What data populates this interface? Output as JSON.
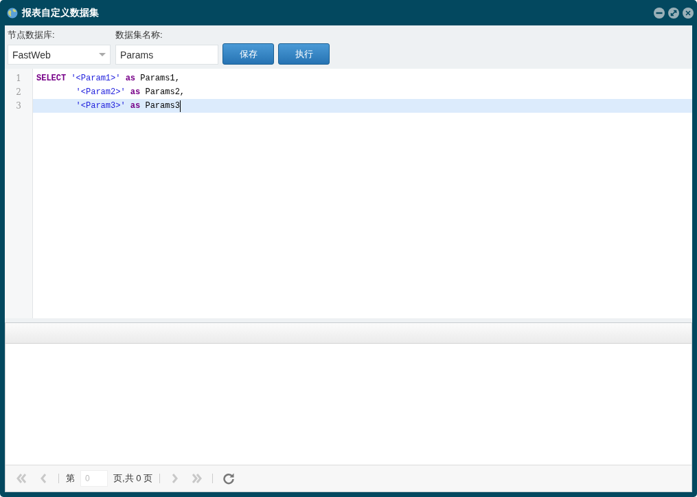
{
  "window": {
    "title": "报表自定义数据集"
  },
  "form": {
    "database": {
      "label": "节点数据库:",
      "value": "FastWeb"
    },
    "name": {
      "label": "数据集名称:",
      "value": "Params"
    },
    "buttons": [
      "保存",
      "执行"
    ]
  },
  "editor": {
    "lines": [
      {
        "number": "1",
        "selected": false,
        "indented": false,
        "tokens": [
          {
            "kind": "keyword",
            "text": "SELECT"
          },
          {
            "kind": "string",
            "text": "'<Param1>'"
          },
          {
            "kind": "keyword",
            "text": "as"
          },
          {
            "kind": "plain",
            "text": "Params1,"
          }
        ]
      },
      {
        "number": "2",
        "selected": false,
        "indented": true,
        "tokens": [
          {
            "kind": "string",
            "text": "'<Param2>'"
          },
          {
            "kind": "keyword",
            "text": "as"
          },
          {
            "kind": "plain",
            "text": "Params2,"
          }
        ]
      },
      {
        "number": "3",
        "selected": true,
        "indented": true,
        "tokens": [
          {
            "kind": "string",
            "text": "'<Param3>'"
          },
          {
            "kind": "keyword",
            "text": "as"
          },
          {
            "kind": "plain",
            "text": "Params3"
          }
        ]
      }
    ]
  },
  "pager": {
    "first_disabled": true,
    "prev_disabled": true,
    "page_prefix": "第",
    "page_value": "0",
    "page_suffix": "页,共 0 页",
    "next_disabled": true,
    "last_disabled": true
  }
}
